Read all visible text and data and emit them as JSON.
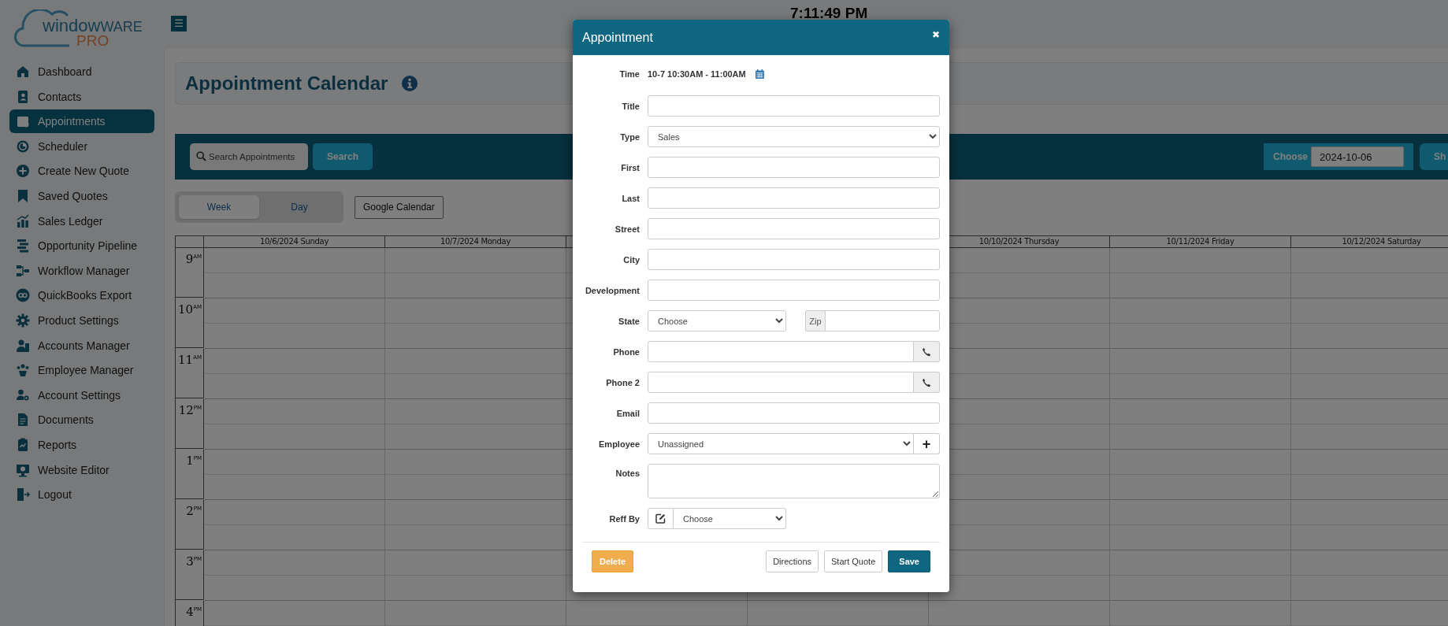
{
  "logo": {
    "name": "window",
    "name_caps": "WARE",
    "tagline": "PRO"
  },
  "sidebar": {
    "items": [
      {
        "label": "Dashboard",
        "selected": false
      },
      {
        "label": "Contacts",
        "selected": false
      },
      {
        "label": "Appointments",
        "selected": true
      },
      {
        "label": "Scheduler",
        "selected": false
      },
      {
        "label": "Create New Quote",
        "selected": false
      },
      {
        "label": "Saved Quotes",
        "selected": false
      },
      {
        "label": "Sales Ledger",
        "selected": false
      },
      {
        "label": "Opportunity Pipeline",
        "selected": false
      },
      {
        "label": "Workflow Manager",
        "selected": false
      },
      {
        "label": "QuickBooks Export",
        "selected": false
      },
      {
        "label": "Product Settings",
        "selected": false
      },
      {
        "label": "Accounts Manager",
        "selected": false
      },
      {
        "label": "Employee Manager",
        "selected": false
      },
      {
        "label": "Account Settings",
        "selected": false
      },
      {
        "label": "Documents",
        "selected": false
      },
      {
        "label": "Reports",
        "selected": false
      },
      {
        "label": "Website Editor",
        "selected": false
      },
      {
        "label": "Logout",
        "selected": false
      }
    ]
  },
  "topbar": {
    "menu_glyph": "☰",
    "clock": "7:11:49 PM"
  },
  "page": {
    "title": "Appointment Calendar"
  },
  "toolbar": {
    "search": {
      "placeholder": "Search Appointments"
    },
    "search_button": "Search",
    "date_label": "Choose",
    "date_value": "2024-10-06",
    "show_button": "Sh"
  },
  "view_tabs": [
    {
      "label": "Week",
      "selected": true
    },
    {
      "label": "Day",
      "selected": false
    }
  ],
  "google_button": "Google Calendar",
  "calendar": {
    "days_left": [
      "10/6/2024 Sunday",
      "10/7/2024 Monday"
    ],
    "days_right": [
      "10/10/2024 Thursday",
      "10/11/2024 Friday",
      "10/12/2024 Saturday"
    ],
    "hours": [
      "9$^{AM}$",
      "10$^{AM}$",
      "11$^{AM}$",
      "12$^{PM}$",
      "1$^{PM}$",
      "2$^{PM}$",
      "3$^{PM}$",
      "4$^{PM}$"
    ]
  },
  "modal": {
    "title": "Appointment",
    "close_glyph": "✖",
    "fields": [
      {
        "label": "Time",
        "kind": "time",
        "value": "10-7 10:30AM - 11:00AM"
      },
      {
        "label": "Title",
        "kind": "text"
      },
      {
        "label": "Type",
        "kind": "select",
        "value": "Sales"
      },
      {
        "label": "First",
        "kind": "text"
      },
      {
        "label": "Last",
        "kind": "text"
      },
      {
        "label": "Street",
        "kind": "text"
      },
      {
        "label": "City",
        "kind": "text"
      },
      {
        "label": "Development",
        "kind": "text"
      },
      {
        "label": "State",
        "kind": "state",
        "value": "Choose",
        "addon": "Zip"
      },
      {
        "label": "Phone",
        "kind": "phone"
      },
      {
        "label": "Phone 2",
        "kind": "phone"
      },
      {
        "label": "Email",
        "kind": "text"
      },
      {
        "label": "Employee",
        "kind": "select_add",
        "value": "Unassigned",
        "addon": "+"
      },
      {
        "label": "Notes",
        "kind": "textarea"
      },
      {
        "label": "Reff By",
        "kind": "reff",
        "value": "Choose"
      }
    ],
    "buttons": [
      {
        "label": "Delete",
        "kind": "warning"
      },
      {
        "label": "Directions",
        "kind": "default"
      },
      {
        "label": "Start Quote",
        "kind": "default"
      },
      {
        "label": "Save",
        "kind": "primary"
      }
    ]
  }
}
